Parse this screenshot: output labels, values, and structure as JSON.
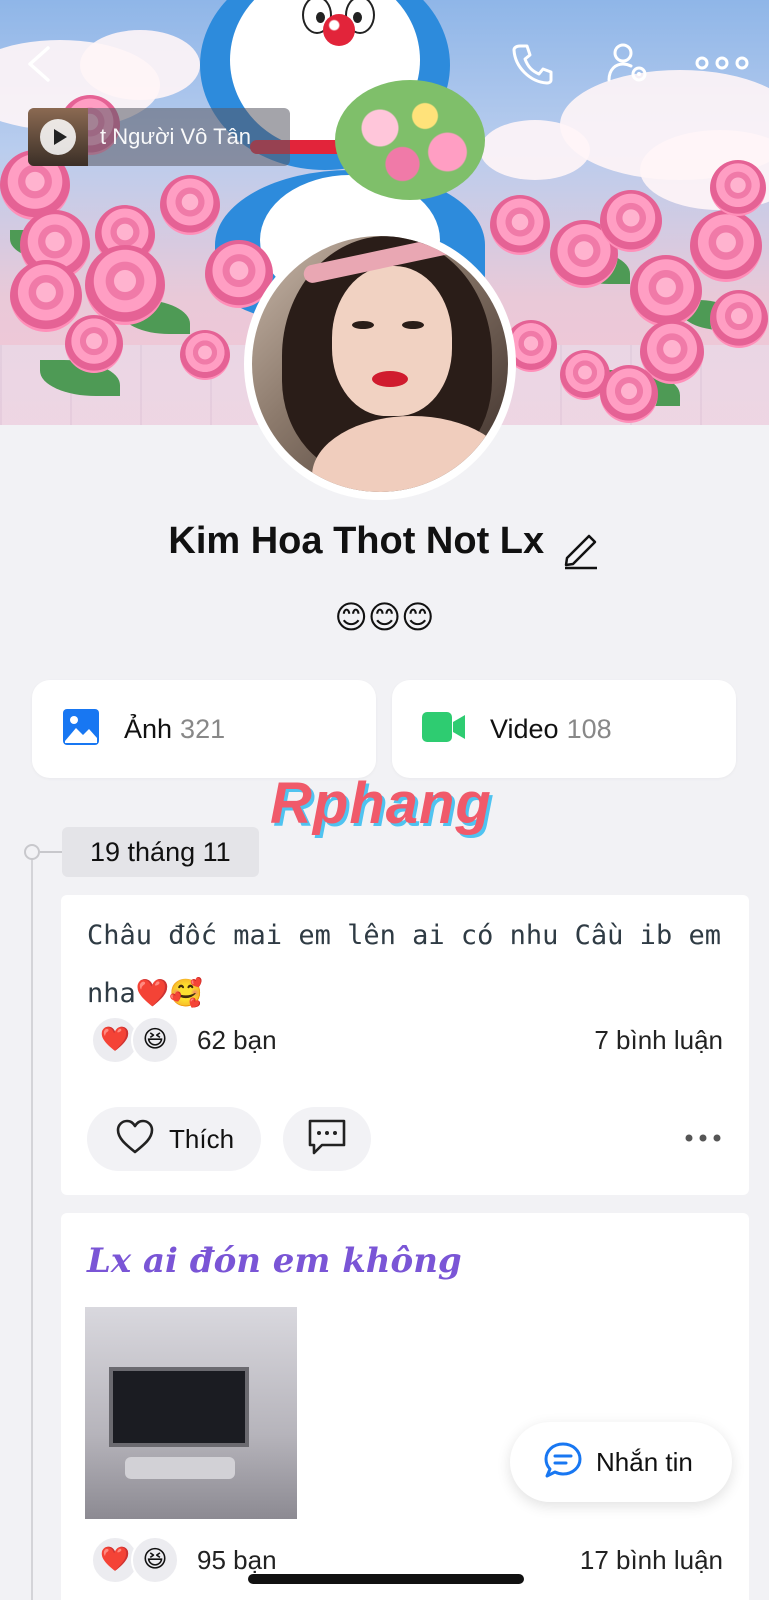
{
  "cover": {
    "music": {
      "title": "t Người Vô Tân"
    }
  },
  "profile": {
    "name": "Kim Hoa Thot Not Lx",
    "bio": "😊😊😊"
  },
  "media": {
    "photos": {
      "label": "Ảnh",
      "count": "321",
      "icon": "image-icon",
      "color": "#1877f2"
    },
    "videos": {
      "label": "Video",
      "count": "108",
      "icon": "video-camera-icon",
      "color": "#2ecc71"
    }
  },
  "watermark": "Rphang",
  "timeline": {
    "date": "19 tháng 11"
  },
  "posts": [
    {
      "text": "Châu đốc mai em lên ai có nhu Cầu ib em nha❤️🥰",
      "reactions": [
        "❤️",
        "😆"
      ],
      "reaction_count": "62 bạn",
      "comment_count": "7 bình luận",
      "like_label": "Thích"
    },
    {
      "heading": "Lx ai đón em không",
      "reactions": [
        "❤️",
        "😆"
      ],
      "reaction_count": "95 bạn",
      "comment_count": "17 bình luận"
    }
  ],
  "fab": {
    "label": "Nhắn tin"
  },
  "colors": {
    "accent": "#1877f2",
    "heading_purple": "#7a55d6",
    "background": "#f2f2f5"
  }
}
